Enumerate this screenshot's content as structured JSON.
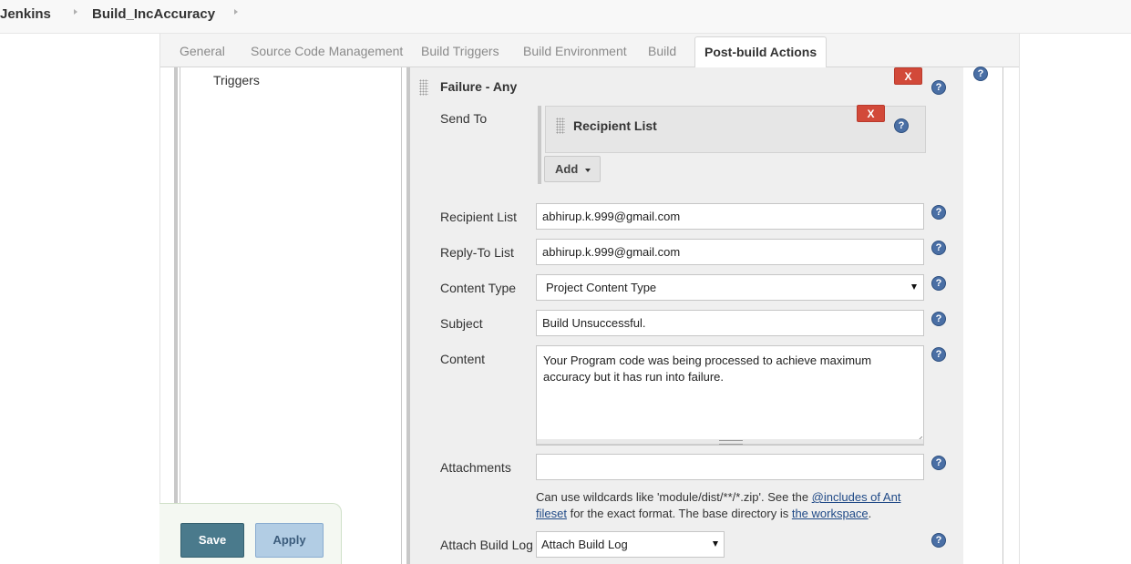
{
  "breadcrumb": {
    "home": "Jenkins",
    "project": "Build_IncAccuracy"
  },
  "tabs": [
    {
      "label": "General"
    },
    {
      "label": "Source Code Management"
    },
    {
      "label": "Build Triggers"
    },
    {
      "label": "Build Environment"
    },
    {
      "label": "Build"
    },
    {
      "label": "Post-build Actions",
      "active": true
    }
  ],
  "left_panel": {
    "triggers_label": "Triggers"
  },
  "trigger_block": {
    "title": "Failure - Any",
    "delete_label": "X",
    "send_to": {
      "label": "Send To",
      "recipient_box_title": "Recipient List",
      "delete_label": "X",
      "add_label": "Add"
    },
    "fields": {
      "recipient_list": {
        "label": "Recipient List",
        "value": "abhirup.k.999@gmail.com"
      },
      "reply_to_list": {
        "label": "Reply-To List",
        "value": "abhirup.k.999@gmail.com"
      },
      "content_type": {
        "label": "Content Type",
        "value": "Project Content Type"
      },
      "subject": {
        "label": "Subject",
        "value": "Build Unsuccessful."
      },
      "content": {
        "label": "Content",
        "value": "Your Program code was being processed to achieve maximum accuracy but it has run into failure."
      },
      "attachments": {
        "label": "Attachments",
        "value": "",
        "hint_prefix": "Can use wildcards like 'module/dist/**/*.zip'. See the ",
        "hint_link1": "@includes of Ant fileset",
        "hint_middle": " for the exact format. The base directory is ",
        "hint_link2": "the workspace",
        "hint_suffix": "."
      },
      "attach_build_log": {
        "label": "Attach Build Log",
        "value": "Attach Build Log"
      }
    }
  },
  "actions": {
    "save_label": "Save",
    "apply_label": "Apply"
  },
  "colors": {
    "delete": "#d24939",
    "help": "#4a6fa5",
    "save": "#4a7a8c",
    "apply": "#b2cde4",
    "link": "#204a87"
  }
}
